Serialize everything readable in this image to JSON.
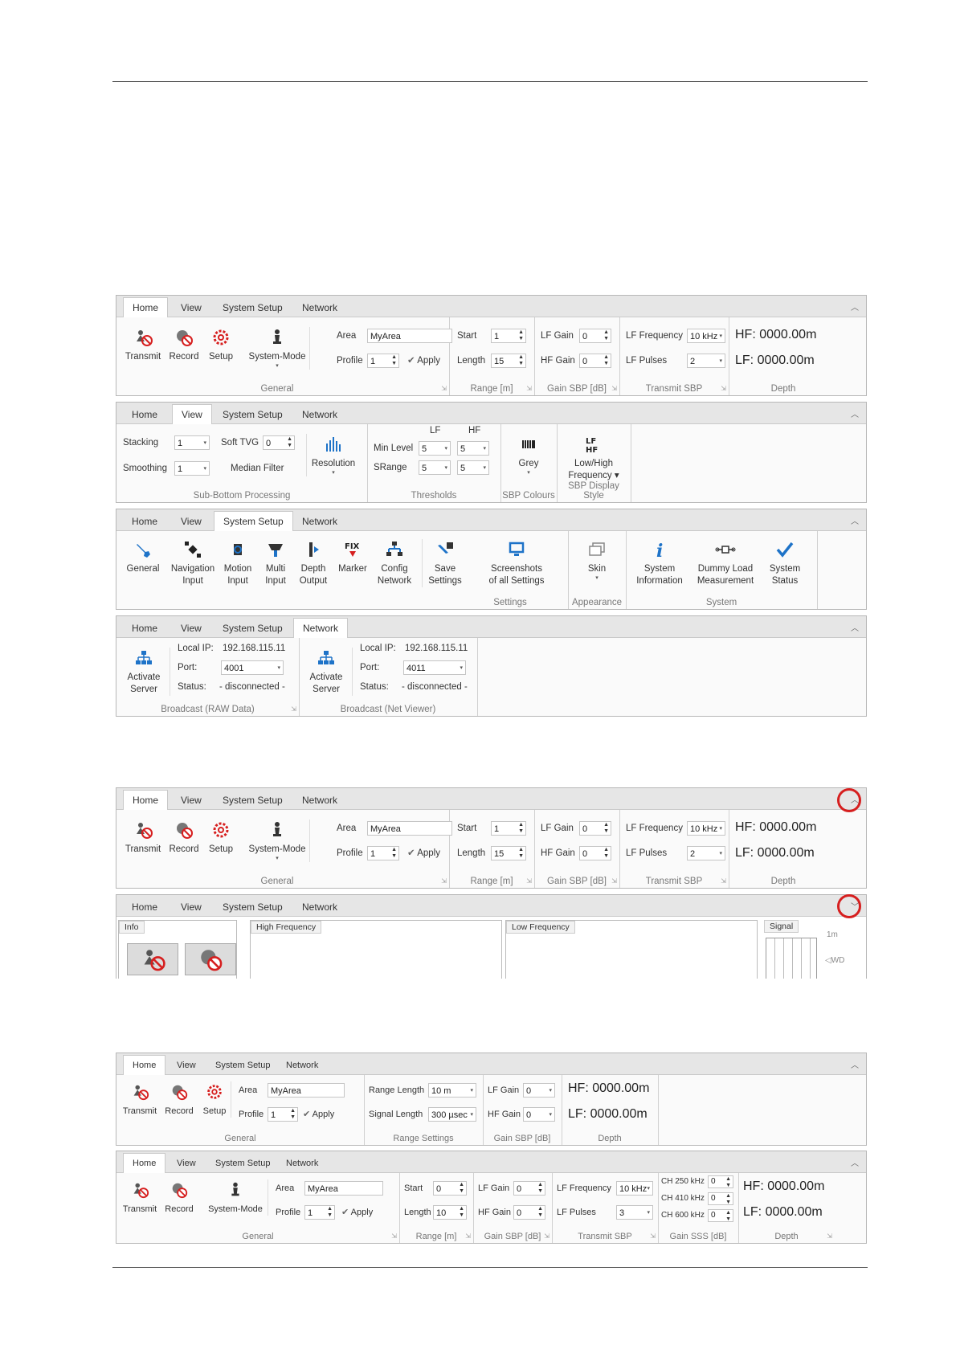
{
  "tabs": [
    "Home",
    "View",
    "System Setup",
    "Network"
  ],
  "home": {
    "transmit": "Transmit",
    "record": "Record",
    "setup": "Setup",
    "system_mode": "System-Mode",
    "area_label": "Area",
    "area_value": "MyArea",
    "profile_label": "Profile",
    "profile_value": "1",
    "apply": "Apply",
    "start_label": "Start",
    "start_value": "1",
    "length_label": "Length",
    "length_value": "15",
    "lf_gain_label": "LF Gain",
    "lf_gain_value": "0",
    "hf_gain_label": "HF Gain",
    "hf_gain_value": "0",
    "lf_freq_label": "LF Frequency",
    "lf_freq_value": "10 kHz",
    "lf_pulses_label": "LF Pulses",
    "lf_pulses_value": "2",
    "hf_depth": "HF:",
    "hf_depth_value": "0000.00m",
    "lf_depth": "LF:",
    "lf_depth_value": "0000.00m",
    "g_general": "General",
    "g_range": "Range [m]",
    "g_gain": "Gain SBP [dB]",
    "g_transmit": "Transmit SBP",
    "g_depth": "Depth"
  },
  "view": {
    "stacking": "Stacking",
    "stacking_value": "1",
    "smoothing": "Smoothing",
    "smoothing_value": "1",
    "soft_tvg": "Soft TVG",
    "soft_tvg_value": "0",
    "median_filter": "Median Filter",
    "resolution": "Resolution",
    "lf": "LF",
    "hf": "HF",
    "min_level": "Min Level",
    "srange": "SRange",
    "lf_min": "5",
    "lf_sr": "5",
    "hf_min": "5",
    "hf_sr": "5",
    "grey": "Grey",
    "low_high_1": "Low/High",
    "low_high_2": "Frequency",
    "g_sub": "Sub-Bottom Processing",
    "g_thr": "Thresholds",
    "g_col": "SBP Colours",
    "g_disp": "SBP Display Style"
  },
  "setup": {
    "items": [
      {
        "l1": "General",
        "l2": ""
      },
      {
        "l1": "Navigation",
        "l2": "Input"
      },
      {
        "l1": "Motion",
        "l2": "Input"
      },
      {
        "l1": "Multi",
        "l2": "Input"
      },
      {
        "l1": "Depth",
        "l2": "Output"
      },
      {
        "l1": "Marker",
        "l2": ""
      },
      {
        "l1": "Config",
        "l2": "Network"
      },
      {
        "l1": "Save",
        "l2": "Settings"
      },
      {
        "l1": "Screenshots",
        "l2": "of all Settings"
      },
      {
        "l1": "Skin",
        "l2": ""
      },
      {
        "l1": "System",
        "l2": "Information"
      },
      {
        "l1": "Dummy Load",
        "l2": "Measurement"
      },
      {
        "l1": "System",
        "l2": "Status"
      }
    ],
    "g_settings": "Settings",
    "g_appearance": "Appearance",
    "g_system": "System"
  },
  "network": {
    "activate_1": "Activate",
    "activate_2": "Server",
    "local_ip": "Local IP:",
    "ip_value": "192.168.115.11",
    "port": "Port:",
    "port_a": "4001",
    "port_b": "4011",
    "status": "Status:",
    "status_value": "- disconnected -",
    "g_raw": "Broadcast (RAW Data)",
    "g_net": "Broadcast (Net Viewer)"
  },
  "panels": {
    "info": "Info",
    "high_freq": "High Frequency",
    "low_freq": "Low Frequency",
    "signal": "Signal",
    "scale_1m": "1m",
    "wd": "◁WD"
  },
  "small": {
    "range_length": "Range Length",
    "range_length_value": "10 m",
    "signal_length": "Signal Length",
    "signal_length_value": "300 µsec",
    "g_range_settings": "Range Settings",
    "start_value": "0",
    "length_value": "10",
    "lf_pulses_value": "3",
    "ch250": "CH 250 kHz",
    "ch410": "CH 410 kHz",
    "ch600": "CH 600 kHz",
    "ch_value": "0",
    "g_sss": "Gain SSS [dB]"
  },
  "colors": {
    "accent": "#1e73c8",
    "red": "#d61f1f",
    "tabbar": "#e6e6e6"
  }
}
